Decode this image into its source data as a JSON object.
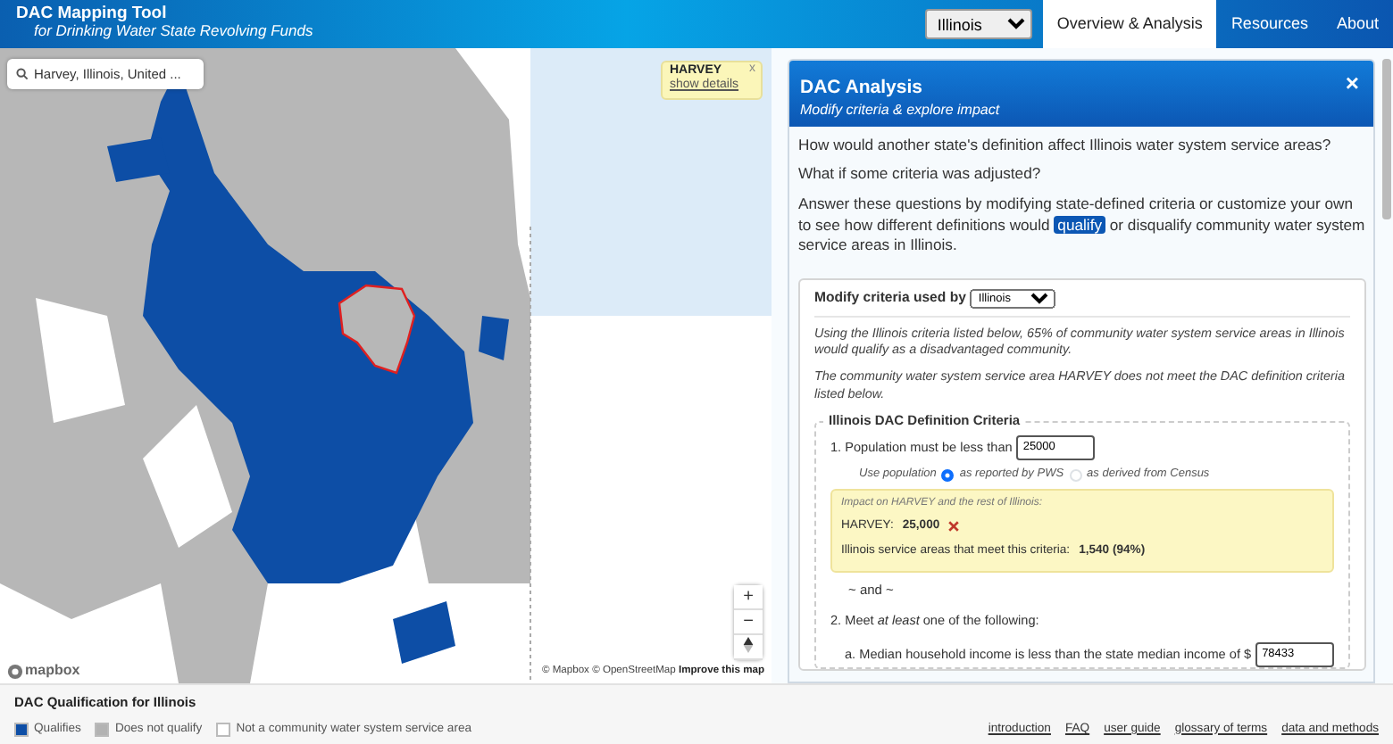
{
  "header": {
    "title": "DAC Mapping Tool",
    "subtitle": "for Drinking Water State Revolving Funds",
    "state_select": "Illinois",
    "nav": [
      {
        "label": "Overview & Analysis",
        "selected": true
      },
      {
        "label": "Resources",
        "selected": false
      },
      {
        "label": "About",
        "selected": false
      }
    ]
  },
  "map": {
    "search": {
      "value": "Harvey, Illinois, United ..."
    },
    "popup": {
      "title": "HARVEY",
      "link": "show details",
      "close": "x"
    },
    "zoom_controls": [
      "+",
      "−"
    ],
    "logo": "mapbox",
    "attribution": "© Mapbox © OpenStreetMap",
    "attribution_link": "Improve this map"
  },
  "panel": {
    "title": "DAC Analysis",
    "subtitle": "Modify criteria & explore impact",
    "close": "×",
    "questions": [
      "How would another state's definition affect Illinois water system service areas?",
      "What if some criteria was adjusted?"
    ],
    "intro_before": "Answer these questions by modifying state-defined criteria or customize your own to see how different definitions would",
    "intro_highlight": "qualify",
    "intro_after": "or disqualify community water system service areas in Illinois.",
    "criteria": {
      "label": "Modify criteria used by",
      "state": "Illinois",
      "summary": "Using the Illinois criteria listed below, 65% of community water system service areas in Illinois would qualify as a disadvantaged community.",
      "status": "The community water system service area HARVEY does not meet the DAC definition criteria listed below.",
      "fieldset_title": "Illinois DAC Definition Criteria",
      "population": {
        "label": "1. Population must be less than",
        "value": "25000",
        "source_label": "Use population",
        "options": [
          {
            "label": "as reported by PWS",
            "selected": true
          },
          {
            "label": "as derived from Census",
            "selected": false
          }
        ],
        "impact": {
          "heading": "Impact on HARVEY and the rest of Illinois:",
          "area_label": "HARVEY:",
          "area_value": "25,000",
          "meets": false,
          "state_label": "Illinois service areas that meet this criteria:",
          "state_value": "1,540 (94%)"
        }
      },
      "connector": "~ and ~",
      "second": {
        "label": "2. Meet *at least* one of the following:",
        "income_label": "a. Median household income is less than the state median income of $",
        "income_value": "78433"
      }
    }
  },
  "footer": {
    "title": "DAC Qualification for Illinois",
    "legend": [
      {
        "label": "Qualifies",
        "color": "#0d4ea6"
      },
      {
        "label": "Does not qualify",
        "color": "#b3b3b3"
      },
      {
        "label": "Not a community water system service area",
        "color": "#ffffff"
      }
    ],
    "links": [
      "introduction",
      "FAQ",
      "user guide",
      "glossary of terms",
      "data and methods"
    ]
  }
}
